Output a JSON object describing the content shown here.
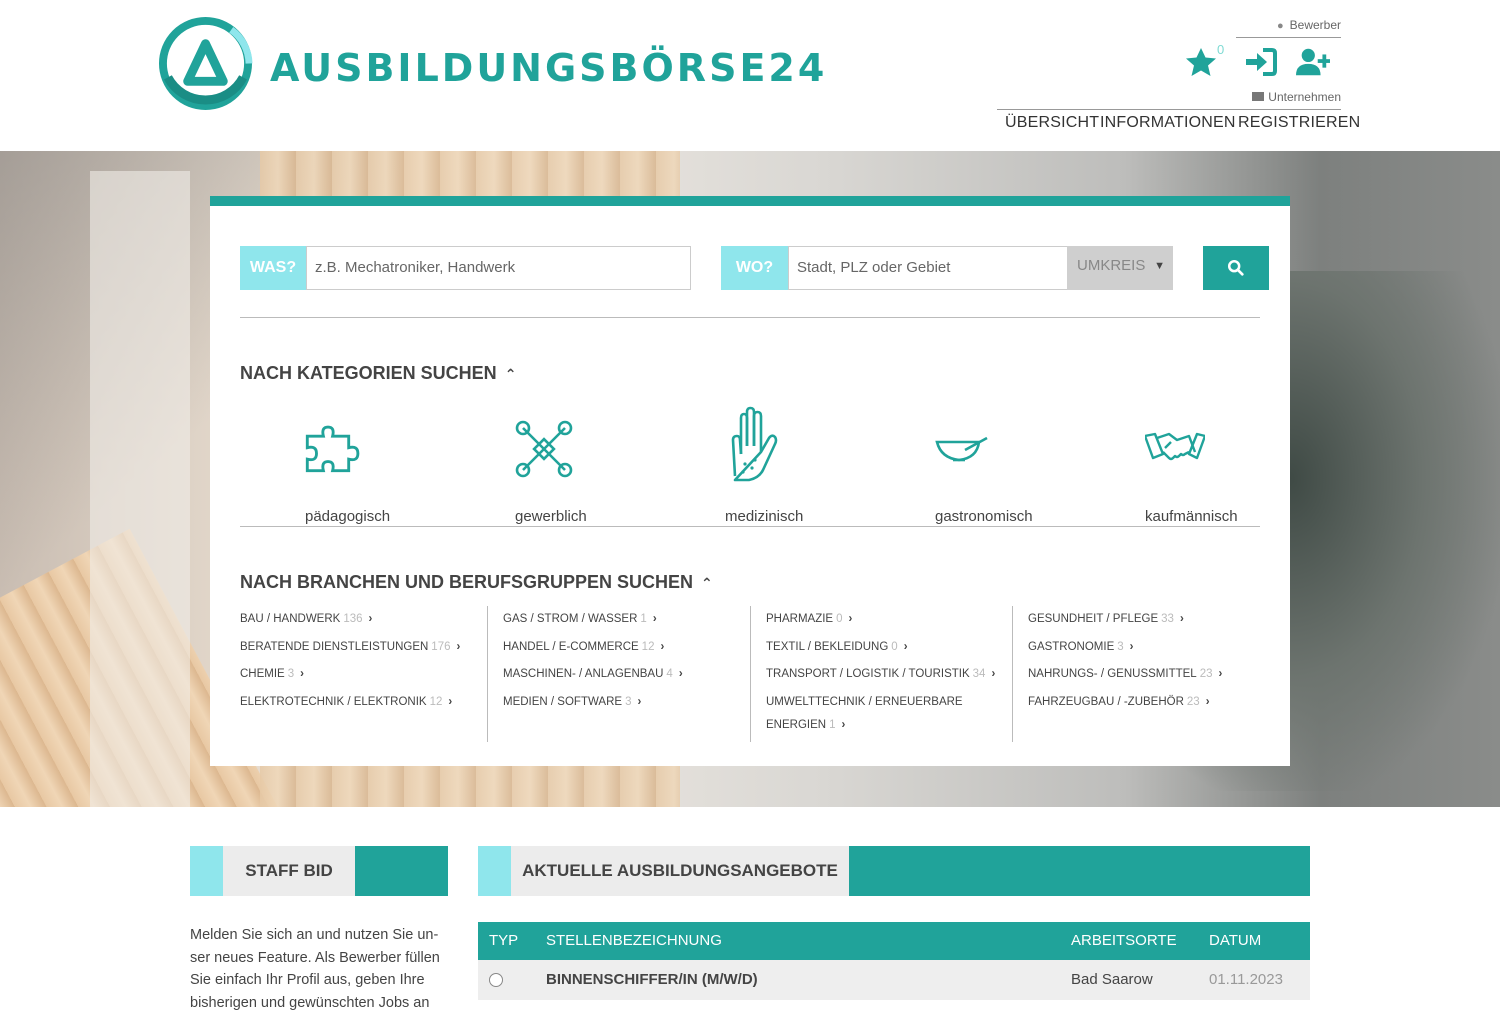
{
  "brand": {
    "name": "AUSBILDUNGSBÖRSE24",
    "color": "#20a39a"
  },
  "header": {
    "bewerber_label": "Bewerber",
    "unternehmen_label": "Unternehmen",
    "favorites_count": "0",
    "icons": [
      "star-icon",
      "sign-in-icon",
      "user-plus-icon"
    ],
    "nav": [
      "ÜBERSICHT",
      "INFORMATIONEN",
      "REGISTRIEREN"
    ]
  },
  "search": {
    "was_label": "WAS?",
    "was_placeholder": "z.B. Mechatroniker, Handwerk",
    "wo_label": "WO?",
    "wo_placeholder": "Stadt, PLZ oder Gebiet",
    "umkreis": "UMKREIS",
    "button_icon": "search-icon"
  },
  "categories": {
    "title": "NACH KATEGORIEN SUCHEN",
    "items": [
      {
        "label": "pädagogisch",
        "icon": "puzzle-icon"
      },
      {
        "label": "gewerblich",
        "icon": "wrench-icon"
      },
      {
        "label": "medizinisch",
        "icon": "hand-icon"
      },
      {
        "label": "gastronomisch",
        "icon": "mortar-icon"
      },
      {
        "label": "kaufmännisch",
        "icon": "handshake-icon"
      }
    ]
  },
  "branches": {
    "title": "NACH BRANCHEN UND BERUFSGRUPPEN SUCHEN",
    "columns": [
      [
        {
          "label": "BAU / HANDWERK",
          "count": "136"
        },
        {
          "label": "BERATENDE DIENSTLEISTUNGEN",
          "count": "176"
        },
        {
          "label": "CHEMIE",
          "count": "3"
        },
        {
          "label": "ELEKTROTECHNIK / ELEKTRONIK",
          "count": "12"
        }
      ],
      [
        {
          "label": "GAS / STROM / WASSER",
          "count": "1"
        },
        {
          "label": "HANDEL / E-COMMERCE",
          "count": "12"
        },
        {
          "label": "MASCHINEN- / ANLAGENBAU",
          "count": "4"
        },
        {
          "label": "MEDIEN / SOFTWARE",
          "count": "3"
        }
      ],
      [
        {
          "label": "PHARMAZIE",
          "count": "0"
        },
        {
          "label": "TEXTIL / BEKLEIDUNG",
          "count": "0"
        },
        {
          "label": "TRANSPORT / LOGISTIK / TOURISTIK",
          "count": "34"
        },
        {
          "label": "UMWELTTECHNIK / ERNEUERBARE",
          "count": ""
        },
        {
          "label": "ENERGIEN",
          "count": "1"
        }
      ],
      [
        {
          "label": "GESUNDHEIT / PFLEGE",
          "count": "33"
        },
        {
          "label": "GASTRONOMIE",
          "count": "3"
        },
        {
          "label": "NAHRUNGS- / GENUSSMITTEL",
          "count": "23"
        },
        {
          "label": "FAHRZEUGBAU / -ZUBEHÖR",
          "count": "23"
        }
      ]
    ]
  },
  "staff_bid": {
    "title": "STAFF BID",
    "text": "Melden Sie sich an und nutzen Sie un- ser neues Feature. Als Bewerber füllen Sie einfach Ihr Profil aus, geben Ihre bisherigen und gewünschten Jobs an"
  },
  "offers": {
    "title": "AKTUELLE AUSBILDUNGSANGEBOTE",
    "columns": [
      "TYP",
      "STELLENBEZEICHNUNG",
      "ARBEITSORTE",
      "DATUM"
    ],
    "rows": [
      {
        "title": "BINNENSCHIFFER/IN (M/W/D)",
        "location": "Bad Saarow",
        "date": "01.11.2023"
      }
    ]
  },
  "colors": {
    "accent": "#20a39a",
    "accent_light": "#8fe6ec"
  }
}
